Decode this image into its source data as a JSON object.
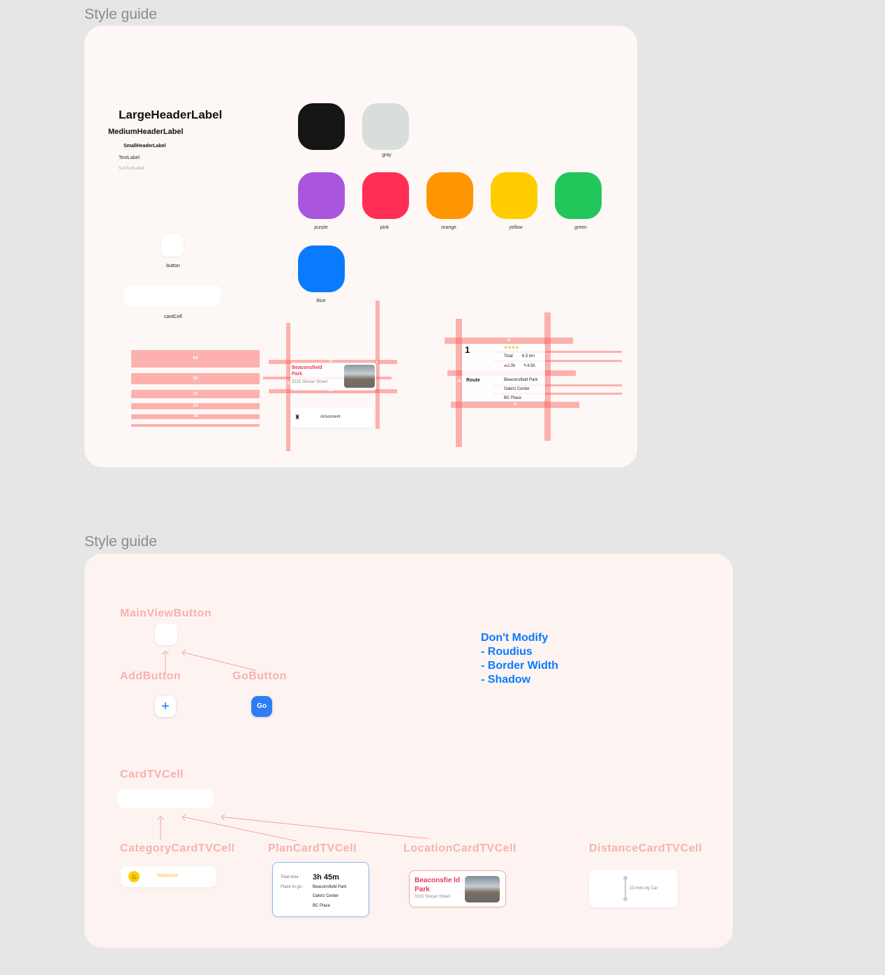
{
  "frame1": {
    "title": "Style guide",
    "typography": {
      "large": "LargeHeaderLabel",
      "medium": "MediumHeaderLabel",
      "small": "SmallHeaderLabel",
      "text": "TextLabel",
      "subtext": "SubTextLabel"
    },
    "button_label": "button",
    "cardcell_label": "cardCell",
    "colors": [
      {
        "name": "",
        "hex": "#151515"
      },
      {
        "name": "gray",
        "hex": "#d9dedd"
      },
      {
        "name": "purple",
        "hex": "#aa55dd"
      },
      {
        "name": "pink",
        "hex": "#ff2e55"
      },
      {
        "name": "orange",
        "hex": "#ff9500"
      },
      {
        "name": "yellow",
        "hex": "#ffcc00"
      },
      {
        "name": "green",
        "hex": "#22c65a"
      },
      {
        "name": "blue",
        "hex": "#0a7aff"
      }
    ],
    "spacing_bars": [
      "64",
      "60",
      "32",
      "24",
      "16"
    ],
    "location_card": {
      "title": "Beaconsfield Park",
      "subtitle": "3215 Slocan Street",
      "m_top": "16",
      "m_bottom": "16",
      "m_left": "8",
      "m_right": "8"
    },
    "category_card": {
      "label": "Amusment"
    },
    "plan_card": {
      "number": "1",
      "stars": "★★★★",
      "total_label": "Total",
      "total_value": "6.5 km",
      "time_car": "2.0h",
      "time_walk": "4.5h",
      "route_label": "Route",
      "places": [
        "Beaconsfield Park",
        "Oakriz Center",
        "BC Place"
      ],
      "m_top": "24",
      "m_mid": "24",
      "m_bottom": "24",
      "m_side": "16"
    }
  },
  "frame2": {
    "title": "Style guide",
    "main_view_button": "MainViewButton",
    "add_button": "AddButton",
    "go_button": "GoButton",
    "go_label": "Go",
    "add_symbol": "+",
    "notice": [
      "Don't Modify",
      "- Roudius",
      "- Border Width",
      "- Shadow"
    ],
    "card_tv_cell": "CardTVCell",
    "category_cell": "CategoryCardTVCell",
    "plan_cell": "PlanCardTVCell",
    "location_cell": "LocationCardTVCell",
    "distance_cell": "DistanceCardTVCell",
    "category_example": {
      "label": "Restaurant"
    },
    "plan_example": {
      "total_time_label": "Total time :",
      "total_time_value": "3h 45m",
      "place_label": "Place to go :",
      "places": [
        "Beaconsfield Park",
        "Oakriz Center",
        "BC Place"
      ]
    },
    "location_example": {
      "title": "Beaconsfie ld Park",
      "subtitle": "3215 Slocan Street"
    },
    "distance_example": {
      "label": "23 mins by Car"
    },
    "accent": "#0a7aff",
    "pink": "#f7b1ad"
  }
}
